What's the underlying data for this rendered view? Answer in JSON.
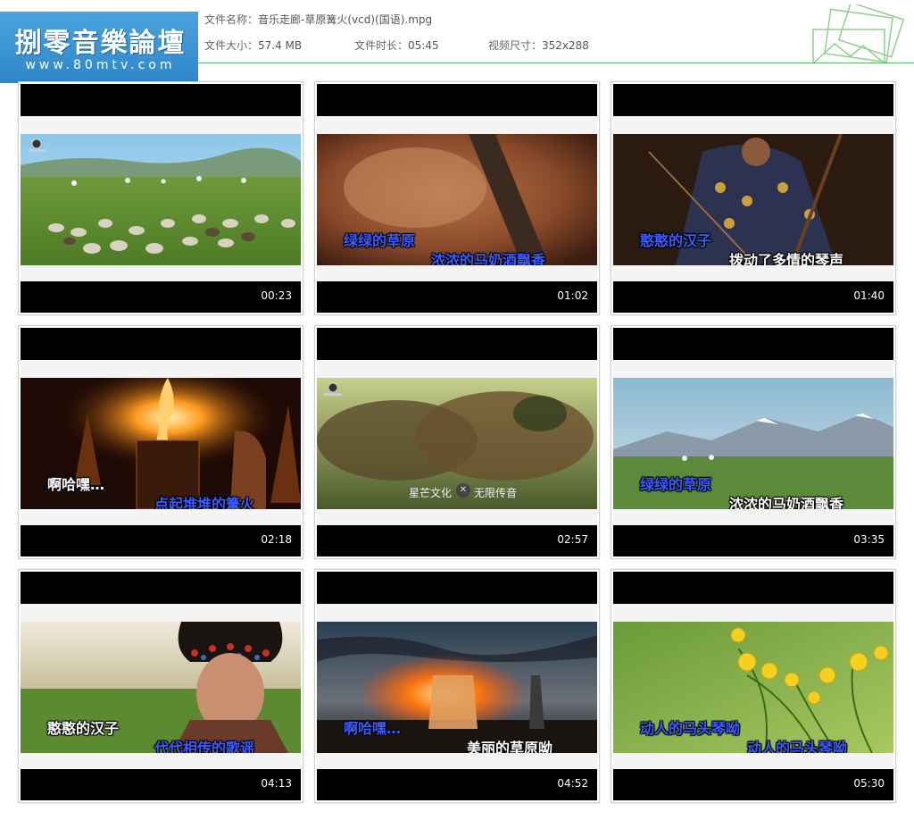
{
  "header": {
    "logo_title": "捌零音樂論壇",
    "logo_url": "www.80mtv.com",
    "file_name_label": "文件名称：",
    "file_name": "音乐走廊-草原篝火(vcd)(国语).mpg",
    "file_size_label": "文件大小：",
    "file_size": "57.4 MB",
    "duration_label": "文件时长：",
    "duration": "05:45",
    "dimensions_label": "视频尺寸：",
    "dimensions": "352x288",
    "accent_color": "#5cb85c",
    "logo_color": "#3a94d4"
  },
  "thumbnails": [
    {
      "time": "00:23",
      "lyrics": []
    },
    {
      "time": "01:02",
      "lyrics": [
        "绿绿的草原",
        "浓浓的马奶酒飘香"
      ]
    },
    {
      "time": "01:40",
      "lyrics": [
        "憨憨的汉子",
        "拨动了多情的琴声"
      ]
    },
    {
      "time": "02:18",
      "lyrics": [
        "啊哈嘿…",
        "点起堆堆的篝火"
      ]
    },
    {
      "time": "02:57",
      "lyrics": [],
      "caption_left": "星芒文化",
      "caption_right": "无限传音"
    },
    {
      "time": "03:35",
      "lyrics": [
        "绿绿的草原",
        "浓浓的马奶酒飘香"
      ]
    },
    {
      "time": "04:13",
      "lyrics": [
        "憨憨的汉子",
        "代代相传的歌谣"
      ]
    },
    {
      "time": "04:52",
      "lyrics": [
        "啊哈嘿…",
        "美丽的草原呦"
      ]
    },
    {
      "time": "05:30",
      "lyrics": [
        "动人的马头琴呦",
        "动人的马头琴呦"
      ]
    }
  ]
}
